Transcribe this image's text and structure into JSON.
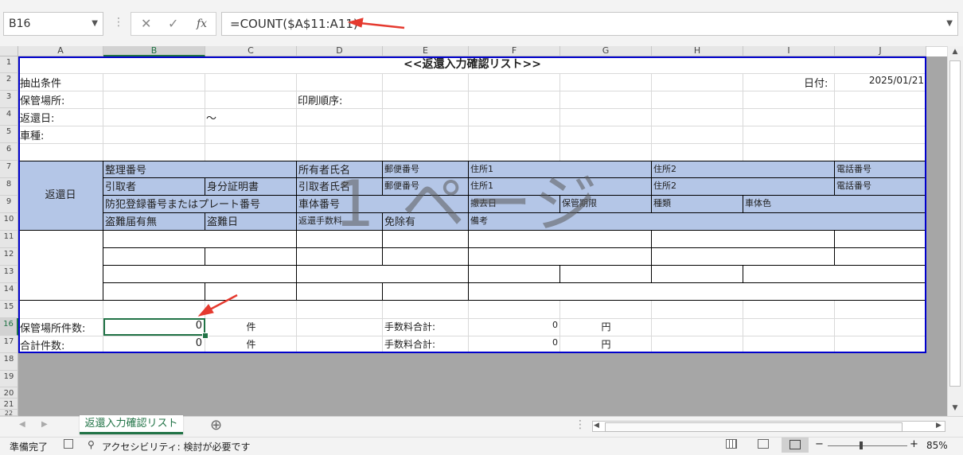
{
  "formula_bar": {
    "name_box": "B16",
    "formula": "=COUNT($A$11:A11)",
    "fx_label": "fx",
    "cancel_icon": "✕",
    "enter_icon": "✓"
  },
  "columns": [
    "A",
    "B",
    "C",
    "D",
    "E",
    "F",
    "G",
    "H",
    "I",
    "J"
  ],
  "rows": [
    "1",
    "2",
    "3",
    "4",
    "5",
    "6",
    "7",
    "8",
    "9",
    "10",
    "11",
    "12",
    "13",
    "14",
    "15",
    "16",
    "17",
    "18",
    "19",
    "20",
    "21",
    "22"
  ],
  "sheet": {
    "title": "<<返還入力確認リスト>>",
    "r2_label": "抽出条件",
    "date_label": "日付:",
    "date_value": "2025/01/21",
    "storage_label": "保管場所:",
    "print_order_label": "印刷順序:",
    "return_date_label": "返還日:",
    "tilde": "～",
    "vehicle_type_label": "車種:",
    "header_left": "返還日",
    "r7": [
      "整理番号",
      "所有者氏名",
      "郵便番号",
      "住所1",
      "住所2",
      "電話番号"
    ],
    "r8": [
      "引取者",
      "身分証明書",
      "引取者氏名",
      "郵便番号",
      "住所1",
      "住所2",
      "電話番号"
    ],
    "r9": [
      "防犯登録番号またはプレート番号",
      "車体番号",
      "撤去日",
      "保管期限",
      "種類",
      "車体色"
    ],
    "r10": [
      "盗難届有無",
      "盗難日",
      "返還手数料",
      "免除有",
      "備考"
    ],
    "r16": {
      "label": "保管場所件数:",
      "count": "0",
      "unit": "件",
      "fee_label": "手数料合計:",
      "fee": "0",
      "yen": "円"
    },
    "r17": {
      "label": "合計件数:",
      "count": "0",
      "unit": "件",
      "fee_label": "手数料合計:",
      "fee": "0",
      "yen": "円"
    },
    "watermark": "1 ページ"
  },
  "tabs": {
    "sheet_tab": "返還入力確認リスト",
    "add_icon": "⊕"
  },
  "status": {
    "ready": "準備完了",
    "accessibility": "アクセシビリティ: 検討が必要です",
    "zoom": "85%",
    "zoom_minus": "−",
    "zoom_plus": "+"
  }
}
